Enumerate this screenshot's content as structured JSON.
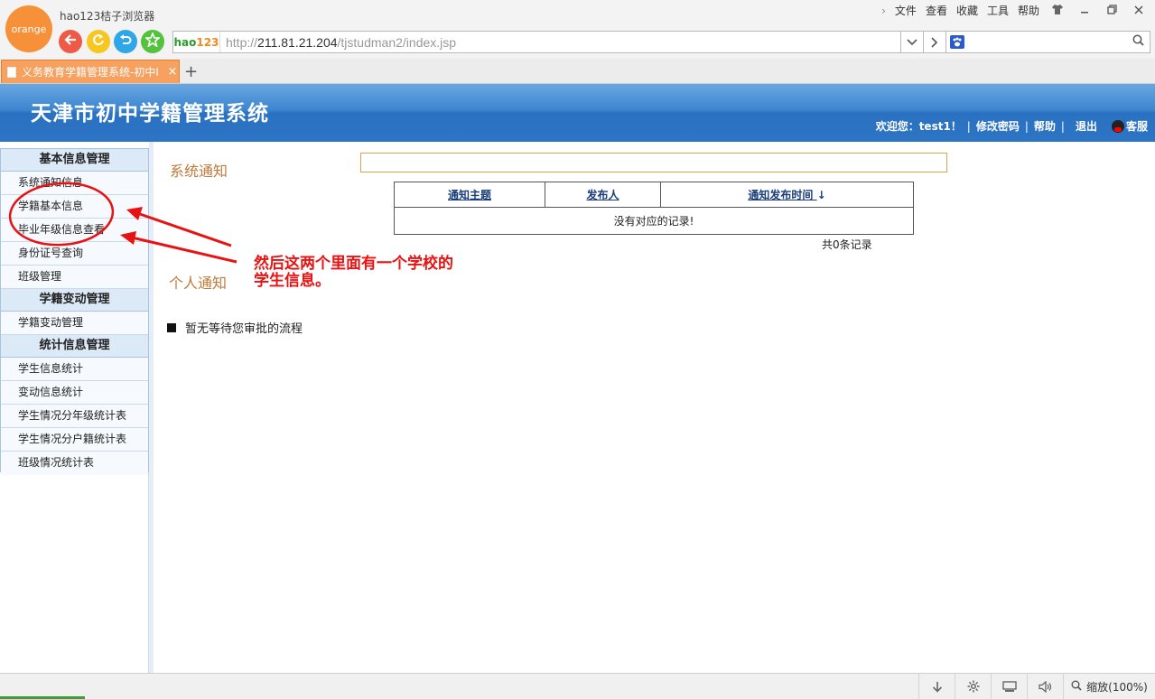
{
  "browser": {
    "logo_text": "orange",
    "app_title": "hao123桔子浏览器",
    "menu": [
      "文件",
      "查看",
      "收藏",
      "工具",
      "帮助"
    ],
    "address": {
      "brand_hao": "hao",
      "brand_num": "123",
      "url_prefix": "http://",
      "url_host": "211.81.21.204",
      "url_path": "/tjstudman2/index.jsp"
    },
    "tab": {
      "title": "义务教育学籍管理系统-初中I"
    },
    "zoom_label": "缩放(100%)"
  },
  "header": {
    "title": "天津市初中学籍管理系统",
    "welcome": "欢迎您：test1！",
    "links": [
      "修改密码",
      "帮助",
      "退出"
    ],
    "service": "客服"
  },
  "sidebar": {
    "sections": [
      {
        "title": "基本信息管理",
        "items": [
          "系统通知信息",
          "学籍基本信息",
          "毕业年级信息查看",
          "身份证号查询",
          "班级管理"
        ]
      },
      {
        "title": "学籍变动管理",
        "items": [
          "学籍变动管理"
        ]
      },
      {
        "title": "统计信息管理",
        "items": [
          "学生信息统计",
          "变动信息统计",
          "学生情况分年级统计表",
          "学生情况分户籍统计表",
          "班级情况统计表"
        ]
      }
    ]
  },
  "main": {
    "system_notice_title": "系统通知",
    "table": {
      "headers": [
        "通知主题",
        "发布人",
        "通知发布时间"
      ],
      "sort_indicator": "↓",
      "empty_text": "没有对应的记录!"
    },
    "record_count": "共0条记录",
    "personal_notice_title": "个人通知",
    "pending_text": "暂无等待您审批的流程"
  },
  "annotation": {
    "line1": "然后这两个里面有一个学校的",
    "line2": "学生信息。",
    "color": "#e81212"
  }
}
